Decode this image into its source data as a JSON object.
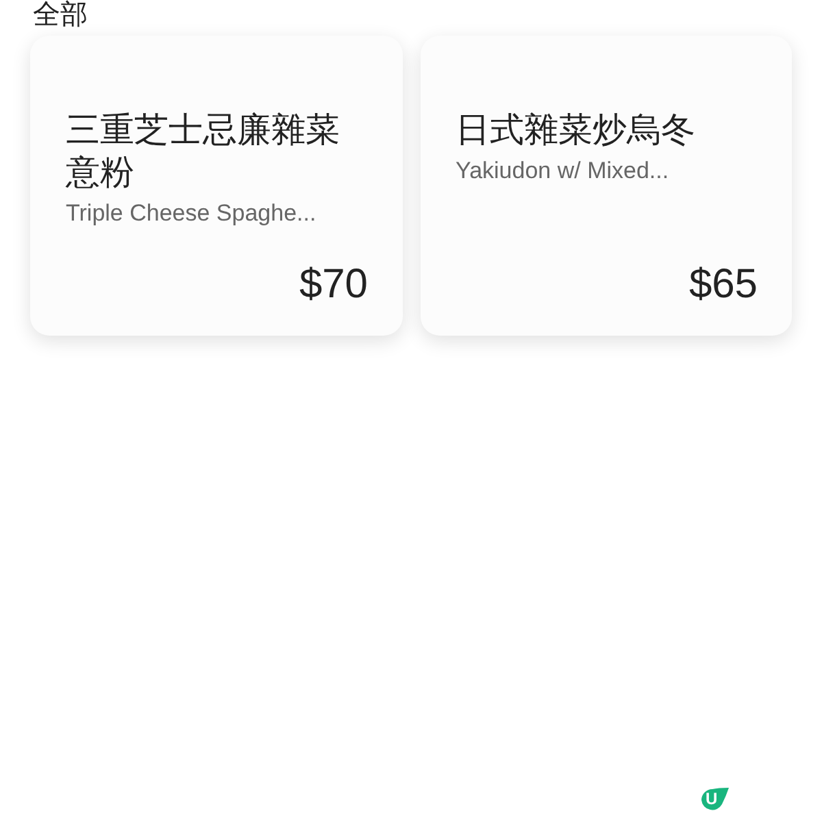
{
  "section": {
    "title": "全部"
  },
  "items": [
    {
      "name": "三重芝士忌廉雜菜意粉",
      "subtitle": "Triple Cheese Spaghe...",
      "price": "$70"
    },
    {
      "name": "日式雜菜炒烏冬",
      "subtitle": "Yakiudon w/ Mixed...",
      "price": "$65"
    }
  ],
  "badge": {
    "label": "U"
  }
}
